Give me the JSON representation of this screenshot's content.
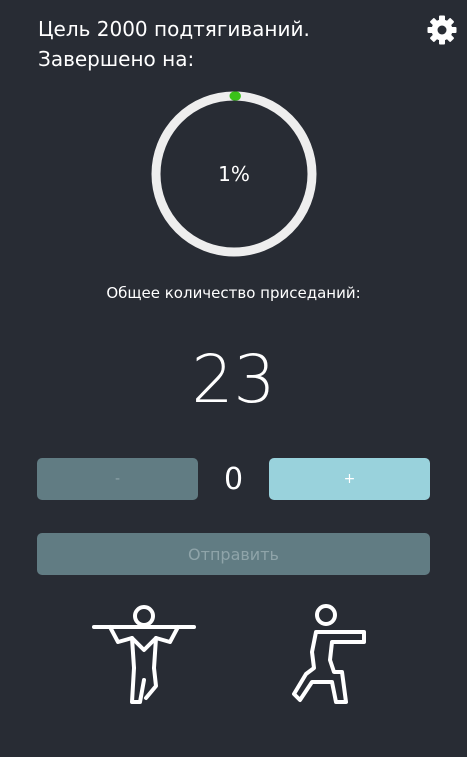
{
  "header": {
    "goal_line_1": "Цель 2000 подтягиваний.",
    "goal_line_2": "Завершено на:"
  },
  "progress": {
    "percent_label": "1%",
    "fraction": 0.01,
    "track_color": "#eeeeee",
    "fill_color": "#3ac219"
  },
  "total": {
    "label": "Общее количество приседаний:",
    "value": "23"
  },
  "counter": {
    "minus_label": "-",
    "value": "0",
    "plus_label": "+"
  },
  "submit": {
    "label": "Отправить"
  },
  "icons": {
    "settings": "gear-icon",
    "pullup": "pullup-icon",
    "squat": "squat-icon"
  },
  "colors": {
    "background": "#282c34",
    "button_disabled": "#617c83",
    "button_active": "#99d2dc"
  }
}
